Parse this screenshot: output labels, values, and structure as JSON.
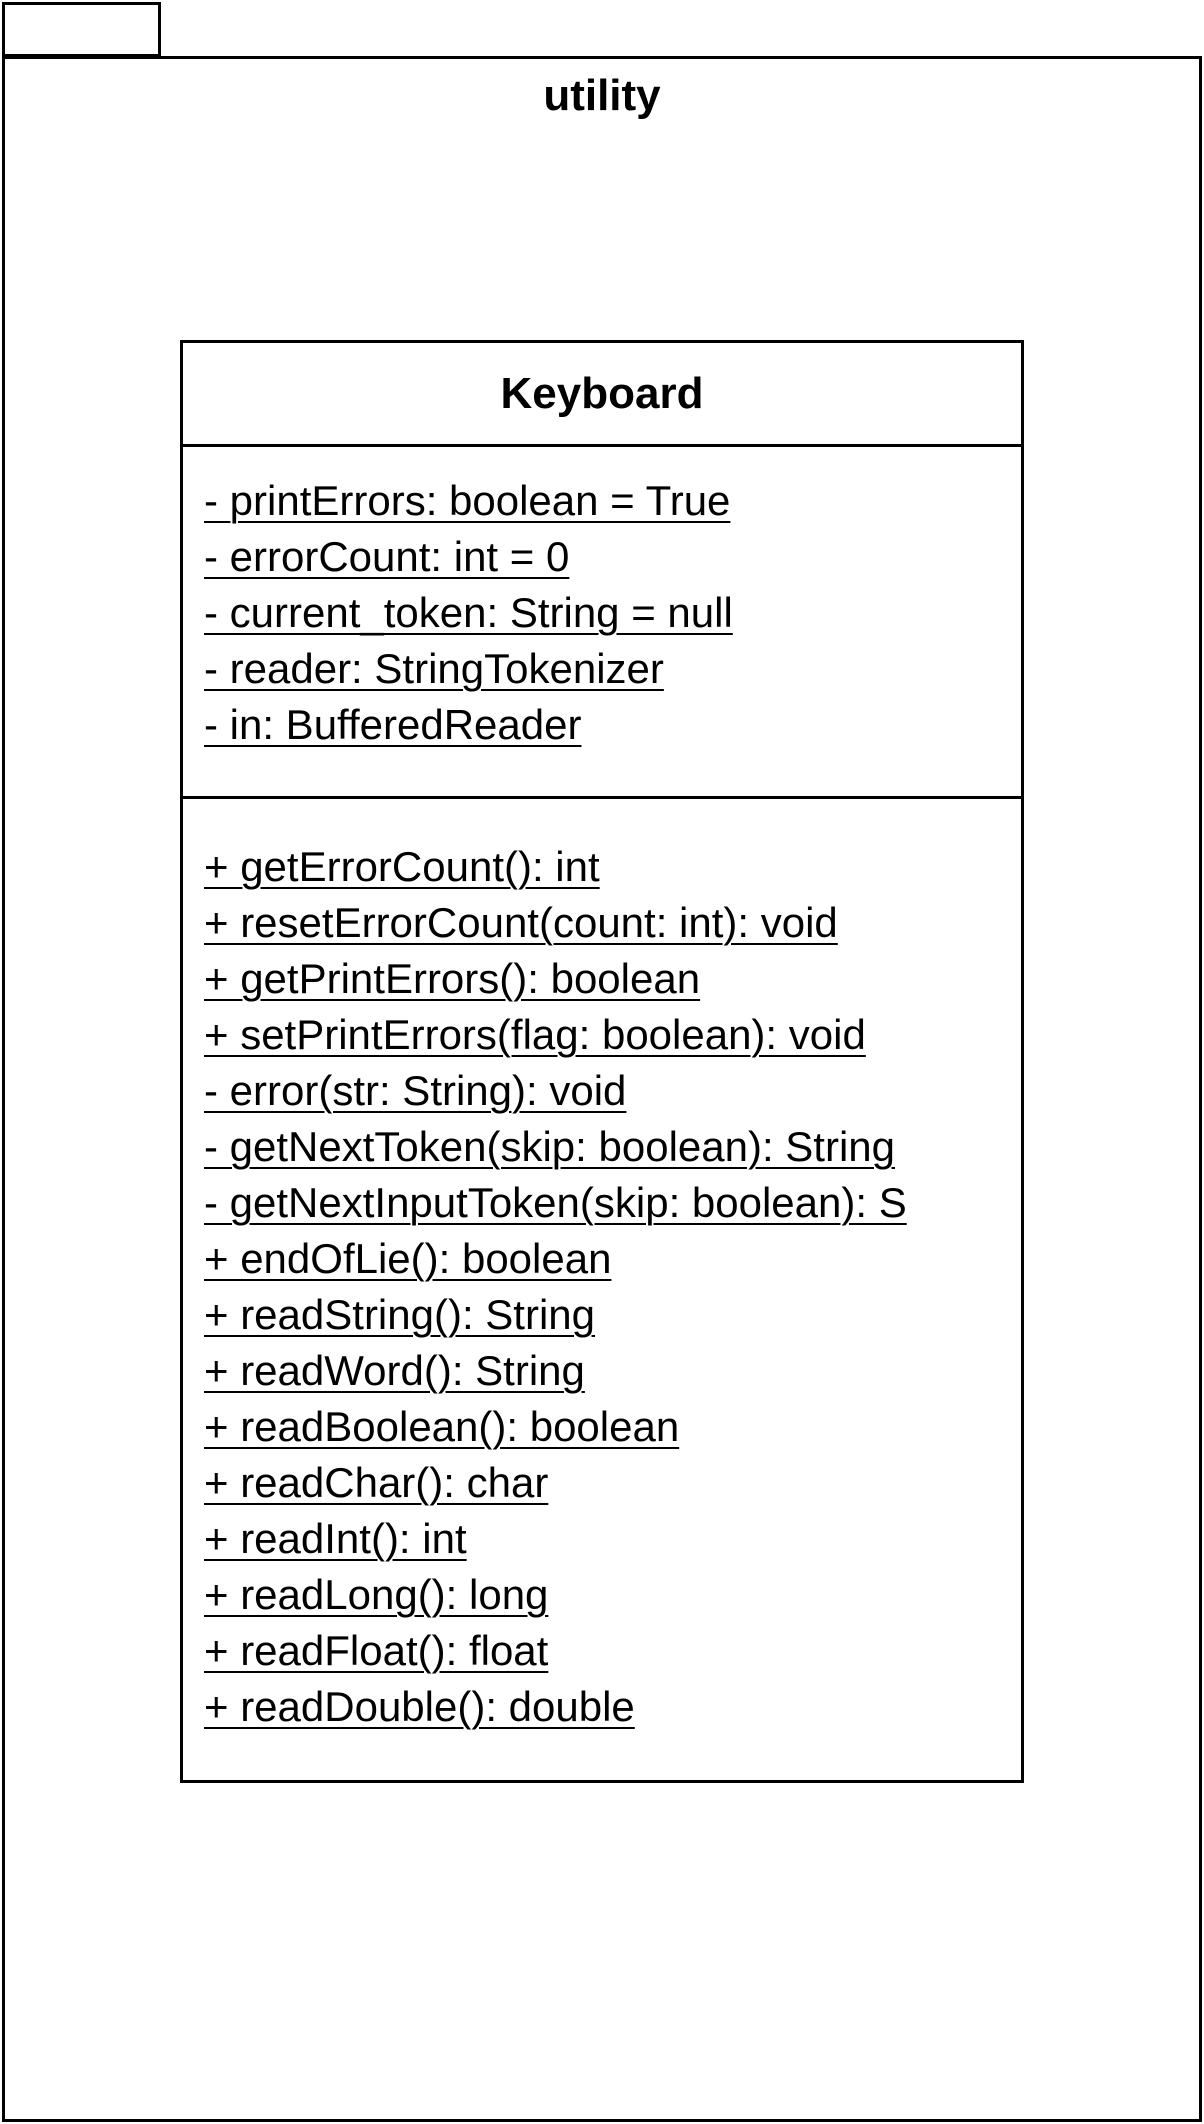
{
  "package": {
    "name": "utility"
  },
  "class": {
    "name": "Keyboard",
    "attributes": [
      "- printErrors: boolean = True",
      "- errorCount: int = 0",
      "- current_token: String = null",
      "- reader: StringTokenizer",
      "- in: BufferedReader"
    ],
    "operations": [
      "+ getErrorCount(): int",
      "+ resetErrorCount(count: int): void",
      "+ getPrintErrors(): boolean",
      "+ setPrintErrors(flag: boolean): void",
      "- error(str: String): void",
      "- getNextToken(skip: boolean): String",
      "- getNextInputToken(skip: boolean): S",
      "+ endOfLie(): boolean",
      "+ readString(): String",
      "+ readWord(): String",
      "+ readBoolean(): boolean",
      "+ readChar(): char",
      "+ readInt(): int",
      "+ readLong(): long",
      "+ readFloat(): float",
      "+ readDouble(): double"
    ]
  }
}
